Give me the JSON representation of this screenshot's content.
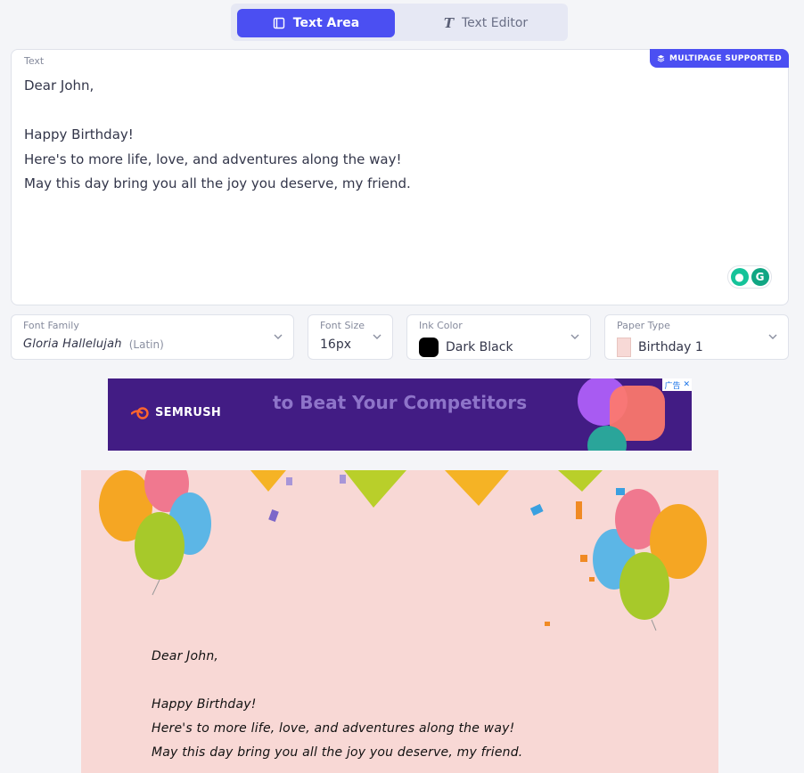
{
  "tabs": [
    {
      "label": "Text Area",
      "icon": "document-icon",
      "active": true
    },
    {
      "label": "Text Editor",
      "icon": "text-format-icon",
      "active": false
    }
  ],
  "editor": {
    "label": "Text",
    "badge": "MULTIPAGE SUPPORTED",
    "content": "Dear John,\n\nHappy Birthday!\nHere's to more life, love, and adventures along the way!\nMay this day bring you all the joy you deserve, my friend."
  },
  "controls": {
    "font_family": {
      "label": "Font Family",
      "value": "Gloria Hallelujah",
      "sub": "(Latin)"
    },
    "font_size": {
      "label": "Font Size",
      "value": "16px"
    },
    "ink_color": {
      "label": "Ink Color",
      "value": "Dark Black",
      "color": "#000000"
    },
    "paper_type": {
      "label": "Paper Type",
      "value": "Birthday 1"
    }
  },
  "ad": {
    "brand": "SEMRUSH",
    "text": "to Beat Your Competitors",
    "badge": "广告"
  },
  "preview": {
    "letter": "Dear John,\n\nHappy Birthday!\nHere's to more life, love, and adventures along the way!\nMay this day bring you all the joy you deserve, my friend."
  },
  "colors": {
    "accent": "#4b4ff2",
    "paper": "#f8d8d5",
    "ad_bg": "#421c84"
  }
}
